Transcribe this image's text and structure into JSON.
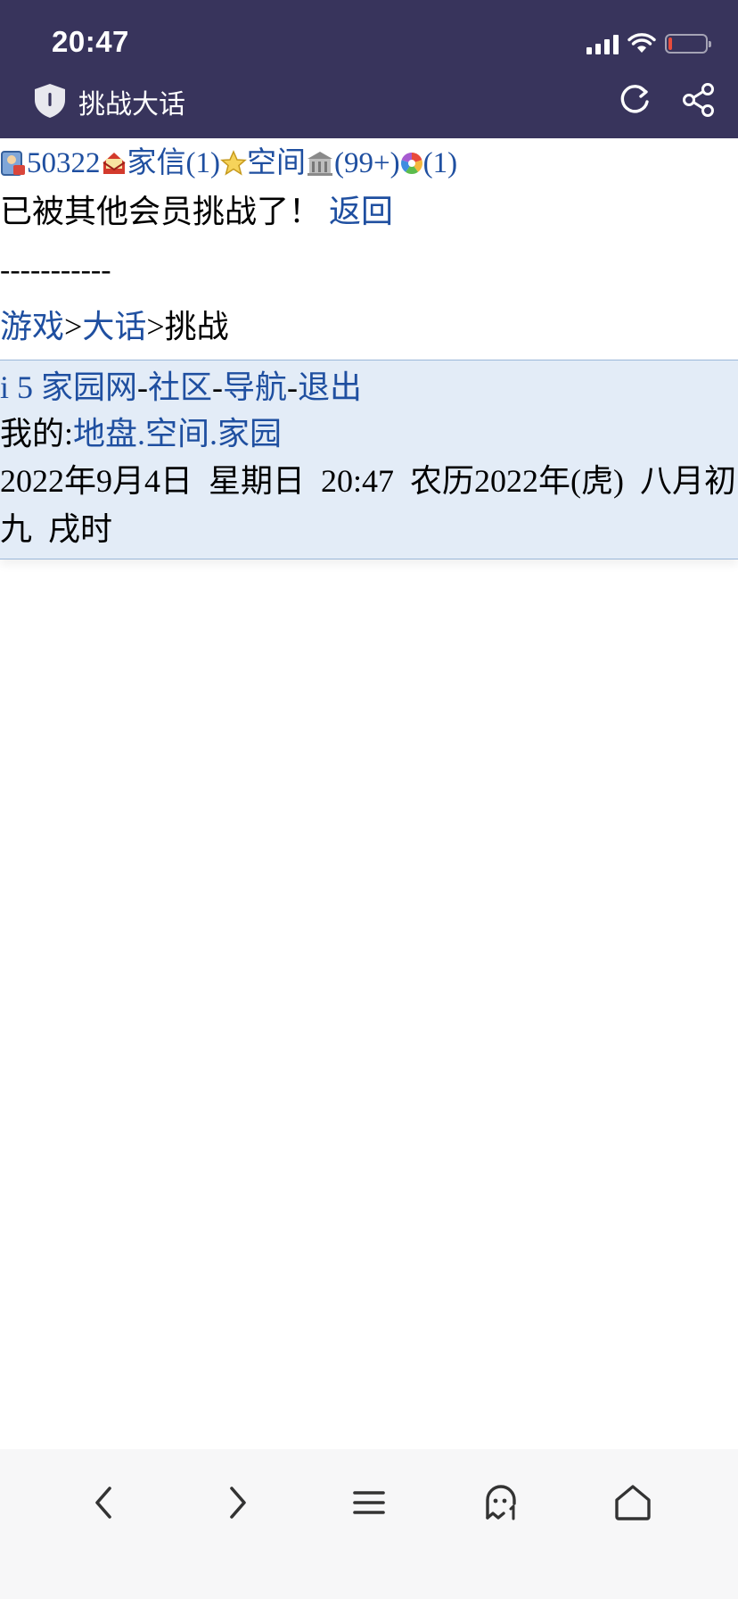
{
  "status_bar": {
    "time": "20:47"
  },
  "header": {
    "title": "挑战大话"
  },
  "user_bar": {
    "user_id": "50322",
    "mail_label": "家信(1)",
    "space_label": "空间",
    "house_count": "(99+)",
    "color_count": "(1)"
  },
  "message": {
    "text": "已被其他会员挑战了！",
    "back_link": "返回"
  },
  "divider": "-----------",
  "breadcrumb": {
    "games": "游戏",
    "sep1": ">",
    "dahua": "大话",
    "sep2": ">",
    "current": "挑战"
  },
  "footer": {
    "site": "i 5 家园网",
    "sep1": "-",
    "community": "社区",
    "sep2": "-",
    "nav": "导航",
    "sep3": "-",
    "logout": "退出",
    "my_label": "我的:",
    "territory": "地盘",
    "dot1": ".",
    "space": "空间",
    "dot2": ".",
    "home": "家园",
    "datetime": "2022年9月4日  星期日  20:47  农历2022年(虎)  八月初九  戌时"
  },
  "battery_level": 0.1,
  "colors": {
    "header_bg": "#38345c",
    "link": "#1f4fa0",
    "footer_bg": "#e3ecf7"
  },
  "icons": [
    "shield-icon",
    "refresh-icon",
    "share-icon",
    "back-icon",
    "forward-icon",
    "menu-icon",
    "ghost-icon",
    "home-icon"
  ]
}
